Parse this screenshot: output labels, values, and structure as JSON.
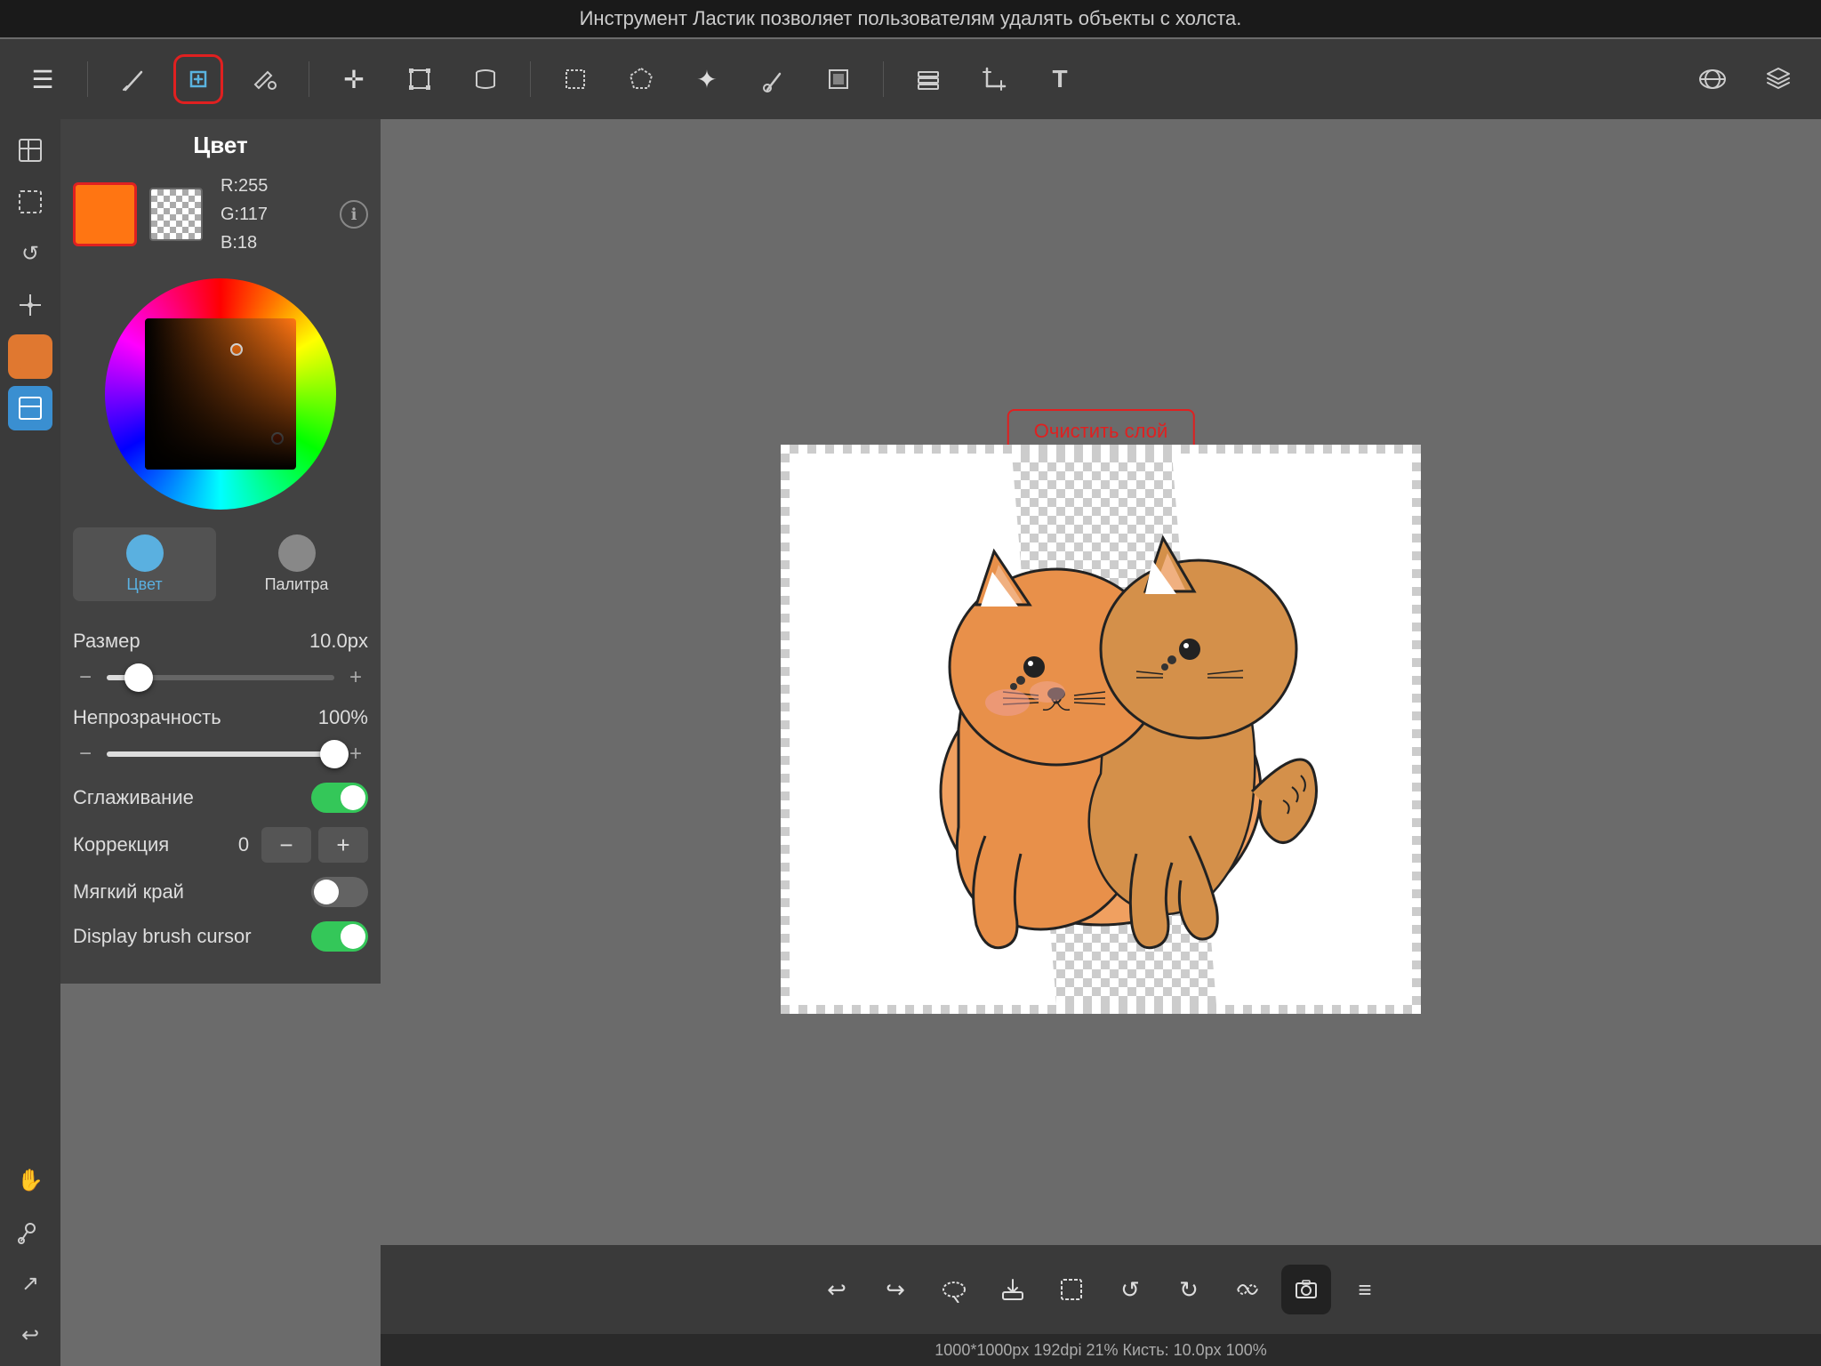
{
  "topBar": {
    "text": "Инструмент Ластик позволяет пользователям удалять объекты с холста."
  },
  "toolbar": {
    "tools": [
      {
        "name": "menu",
        "icon": "☰"
      },
      {
        "name": "pencil",
        "icon": "✏️"
      },
      {
        "name": "eraser",
        "icon": "◇",
        "active": true
      },
      {
        "name": "fill",
        "icon": "✒️"
      },
      {
        "name": "move",
        "icon": "✛"
      },
      {
        "name": "transform",
        "icon": "⤢"
      },
      {
        "name": "warp",
        "icon": "⤡"
      },
      {
        "name": "select-rect",
        "icon": "▭"
      },
      {
        "name": "select-lasso",
        "icon": "⬡"
      },
      {
        "name": "magic-select",
        "icon": "✦"
      },
      {
        "name": "color-pick",
        "icon": "✏"
      },
      {
        "name": "paint",
        "icon": "⬦"
      },
      {
        "name": "layers",
        "icon": "⧉"
      },
      {
        "name": "crop",
        "icon": "⤤"
      },
      {
        "name": "text",
        "icon": "T"
      },
      {
        "name": "share",
        "icon": "⊕"
      },
      {
        "name": "layer-stack",
        "icon": "⧉"
      }
    ]
  },
  "colorPanel": {
    "title": "Цвет",
    "r": 255,
    "g": 117,
    "b": 18,
    "rgb_text": "R:255\nG:117\nB:18",
    "tabs": [
      {
        "id": "color",
        "label": "Цвет",
        "active": true
      },
      {
        "id": "palette",
        "label": "Палитра",
        "active": false
      }
    ]
  },
  "toolPanel": {
    "title": "Инструмент Ластик",
    "size": {
      "label": "Размер",
      "value": "10.0px",
      "percent": 14,
      "minus": "−",
      "plus": "+"
    },
    "opacity": {
      "label": "Непрозрачность",
      "value": "100%",
      "percent": 100,
      "minus": "−",
      "plus": "+"
    },
    "smoothing": {
      "label": "Сглаживание",
      "enabled": true
    },
    "correction": {
      "label": "Коррекция",
      "value": "0",
      "minus": "−",
      "plus": "+"
    },
    "softEdge": {
      "label": "Мягкий край",
      "enabled": false
    },
    "displayBrushCursor": {
      "label": "Display brush cursor",
      "enabled": true
    }
  },
  "canvasInfo": {
    "clearButton": "Очистить слой",
    "statusText": "1000*1000px 192dpi 21% Кисть: 10.0px 100%"
  },
  "bottomToolbar": {
    "tools": [
      {
        "name": "undo",
        "icon": "↩"
      },
      {
        "name": "redo",
        "icon": "↪"
      },
      {
        "name": "rotate-ccw-small",
        "icon": "↺"
      },
      {
        "name": "save-cloud",
        "icon": "⬆"
      },
      {
        "name": "select",
        "icon": "▭"
      },
      {
        "name": "rotate-ccw",
        "icon": "↺"
      },
      {
        "name": "rotate-cw",
        "icon": "↻"
      },
      {
        "name": "flip",
        "icon": "⟲"
      },
      {
        "name": "camera",
        "icon": "▪"
      },
      {
        "name": "menu",
        "icon": "≡"
      }
    ]
  },
  "leftSidebar": {
    "tools": [
      {
        "name": "layers-panel",
        "icon": "⬛",
        "active": false
      },
      {
        "name": "selection-tool",
        "icon": "⬚",
        "active": false
      },
      {
        "name": "rotate",
        "icon": "↺",
        "active": false
      },
      {
        "name": "guides",
        "icon": "⊞",
        "active": false
      },
      {
        "name": "brush",
        "icon": "🖌",
        "active": true,
        "type": "orange"
      },
      {
        "name": "layer-panel2",
        "icon": "⬛",
        "active": false
      },
      {
        "name": "hand",
        "icon": "✋",
        "active": false
      },
      {
        "name": "eyedropper",
        "icon": "💉",
        "active": false
      },
      {
        "name": "share2",
        "icon": "↗",
        "active": false
      },
      {
        "name": "back",
        "icon": "↩",
        "active": false
      }
    ]
  }
}
